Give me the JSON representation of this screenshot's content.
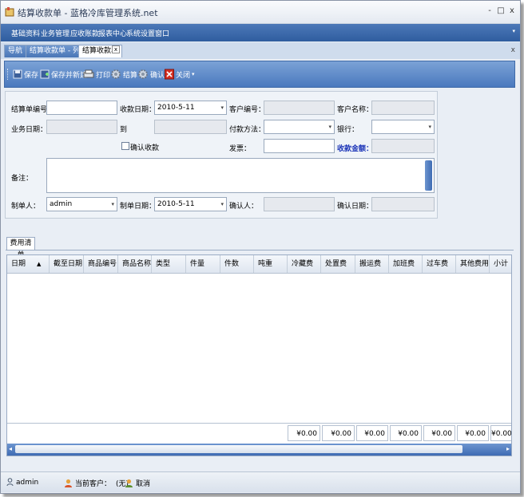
{
  "window": {
    "title": "结算收款单 - 蓝格冷库管理系统.net",
    "buttons": {
      "minimize": "-",
      "maximize": "□",
      "close": "x"
    }
  },
  "menu": {
    "items": [
      "基础资料",
      "业务管理",
      "应收账款",
      "报表中心",
      "系统设置",
      "窗口"
    ]
  },
  "tabs": {
    "items": [
      "导航",
      "结算收款单 - 列表",
      "结算收款单"
    ],
    "close_label": "x",
    "bar_close": "x"
  },
  "toolbar": {
    "save": "保存",
    "save_new": "保存并新建",
    "print": "打印",
    "settle": "结算",
    "confirm": "确认",
    "close": "关闭"
  },
  "form": {
    "settle_no_label": "结算单编号：",
    "settle_no_value": "",
    "receipt_date_label": "收款日期：",
    "receipt_date_value": "2010-5-11",
    "customer_no_label": "客户编号：",
    "customer_no_value": "",
    "customer_name_label": "客户名称：",
    "customer_name_value": "",
    "biz_date_from_label": "业务日期：从",
    "biz_date_from_value": "",
    "to_label": "到",
    "biz_date_to_value": "",
    "pay_method_label": "付款方法：",
    "pay_method_value": "",
    "bank_label": "银行：",
    "bank_value": "",
    "confirm_receipt_label": "确认收款",
    "invoice_label": "发票：",
    "invoice_value": "",
    "amount_label": "收款金额：",
    "amount_value": "",
    "remark_label": "备注：",
    "remark_value": "",
    "creator_label": "制单人：",
    "creator_value": "admin",
    "create_date_label": "制单日期：",
    "create_date_value": "2010-5-11",
    "confirmer_label": "确认人：",
    "confirmer_value": "",
    "confirm_date_label": "确认日期：",
    "confirm_date_value": ""
  },
  "grid": {
    "tab_label": "费用清单",
    "columns": [
      "日期",
      "截至日期",
      "商品编号",
      "商品名称",
      "类型",
      "件量",
      "件数",
      "吨重",
      "冷藏费",
      "处置费",
      "搬运费",
      "加班费",
      "过车费",
      "其他费用",
      "小计"
    ],
    "sort_indicator": "▲",
    "totals": [
      "¥0.00",
      "¥0.00",
      "¥0.00",
      "¥0.00",
      "¥0.00",
      "¥0.00",
      "¥0.00"
    ]
  },
  "statusbar": {
    "user": "admin",
    "current_customer_label": "当前客户：",
    "current_customer_value": "(无)",
    "cancel": "取消"
  },
  "colors": {
    "accent": "#3f6db4",
    "link_blue": "#1c35b8"
  }
}
